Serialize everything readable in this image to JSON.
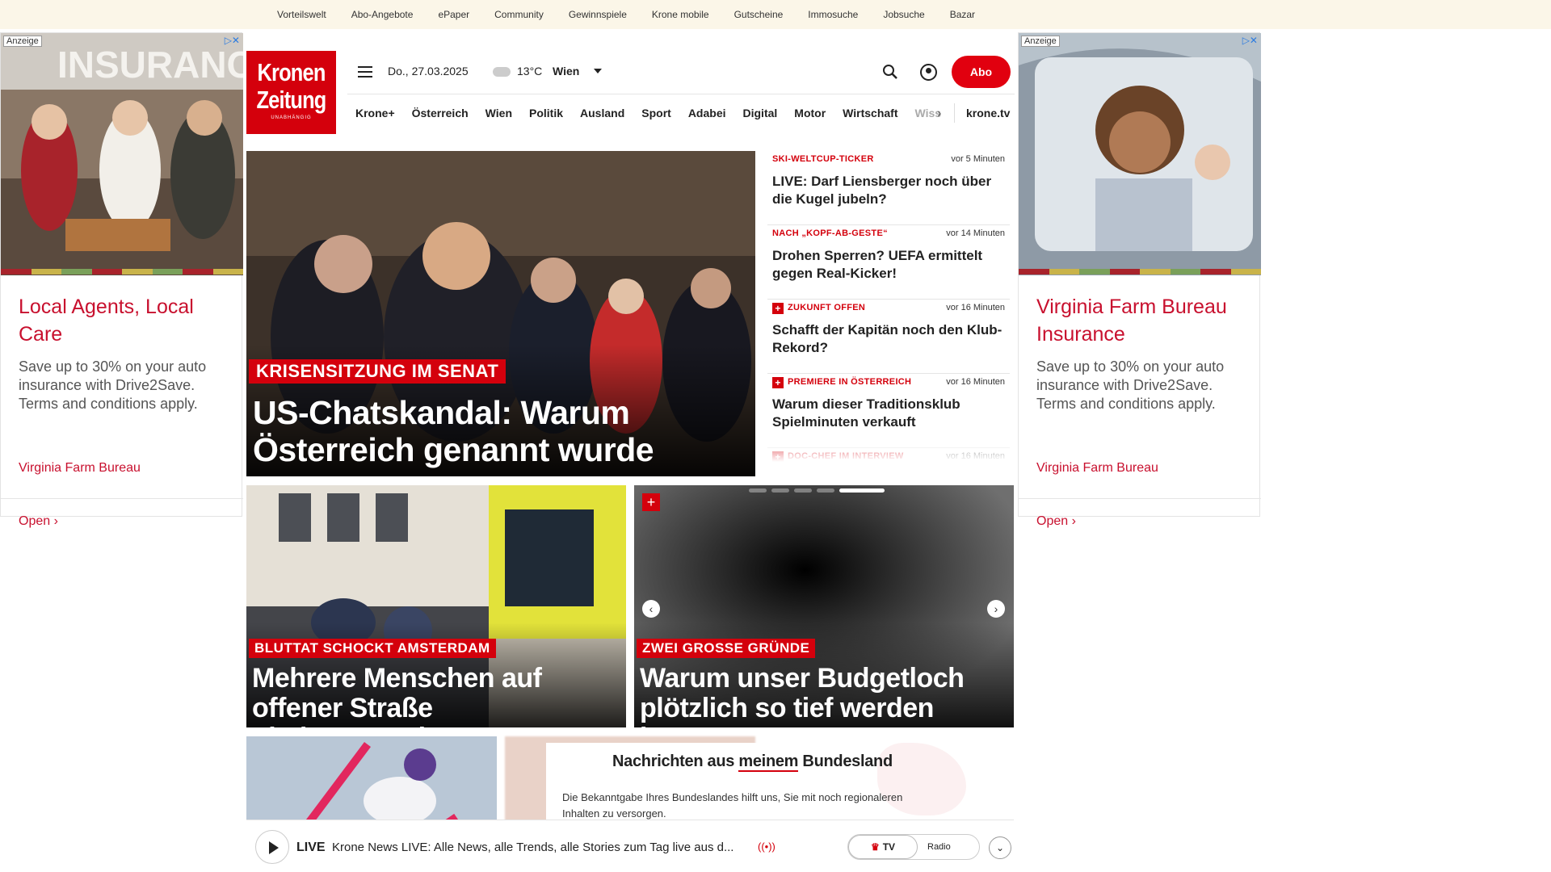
{
  "topnav": [
    "Vorteilswelt",
    "Abo-Angebote",
    "ePaper",
    "Community",
    "Gewinnspiele",
    "Krone mobile",
    "Gutscheine",
    "Immosuche",
    "Jobsuche",
    "Bazar"
  ],
  "ads": {
    "label": "Anzeige",
    "left": {
      "headline": "Local Agents, Local Care",
      "body": "Save up to 30% on your auto insurance with Drive2Save. Terms and conditions apply.",
      "brand": "Virginia Farm Bureau",
      "cta": "Open",
      "image_text": "INSURANC"
    },
    "right": {
      "headline": "Virginia Farm Bureau Insurance",
      "body": "Save up to 30% on your auto insurance with Drive2Save. Terms and conditions apply.",
      "brand": "Virginia Farm Bureau",
      "cta": "Open"
    }
  },
  "header": {
    "logo_line1": "Kronen",
    "logo_line2": "Zeitung",
    "logo_tag": "UNABHÄNGIG",
    "date": "Do., 27.03.2025",
    "temperature": "13°C",
    "city": "Wien",
    "abo_label": "Abo",
    "krone_tv": "krone.tv"
  },
  "nav": [
    "Krone+",
    "Österreich",
    "Wien",
    "Politik",
    "Ausland",
    "Sport",
    "Adabei",
    "Digital",
    "Motor",
    "Wirtschaft",
    "Wiss"
  ],
  "hero": {
    "kicker": "KRISENSITZUNG IM SENAT",
    "title": "US-Chatskandal: Warum Österreich genannt wurde"
  },
  "ticker": [
    {
      "kicker": "SKI-WELTCUP-TICKER",
      "time": "vor 5 Minuten",
      "headline": "LIVE: Darf Liensberger noch über die Kugel jubeln?",
      "plus": false
    },
    {
      "kicker": "NACH „KOPF-AB-GESTE“",
      "time": "vor 14 Minuten",
      "headline": "Drohen Sperren? UEFA ermittelt gegen Real-Kicker!",
      "plus": false
    },
    {
      "kicker": "ZUKUNFT OFFEN",
      "time": "vor 16 Minuten",
      "headline": "Schafft der Kapitän noch den Klub-Rekord?",
      "plus": true
    },
    {
      "kicker": "PREMIERE IN ÖSTERREICH",
      "time": "vor 16 Minuten",
      "headline": "Warum dieser Traditionsklub Spielminuten verkauft",
      "plus": true
    },
    {
      "kicker": "DOC-CHEF IM INTERVIEW",
      "time": "vor 16 Minuten",
      "headline": "",
      "plus": true
    }
  ],
  "cards": [
    {
      "kicker": "BLUTTAT SCHOCKT AMSTERDAM",
      "title": "Mehrere Menschen auf offener Straße niedergestochen"
    },
    {
      "kicker": "ZWEI GROSSE GRÜNDE",
      "title": "Warum unser Budgetloch plötzlich so tief werden konnte"
    }
  ],
  "modal": {
    "title_pre": "Nachrichten aus ",
    "title_u": "meinem",
    "title_post": " Bundesland",
    "body": "Die Bekanntgabe Ihres Bundeslandes hilft uns, Sie mit noch regionaleren Inhalten zu versorgen."
  },
  "livebar": {
    "live": "LIVE",
    "text": "Krone News LIVE: Alle News, alle Trends, alle Stories zum Tag live aus d...",
    "tv": "TV",
    "radio": "Radio"
  },
  "colors": {
    "brand_red": "#d4000c",
    "ad_red": "#c8102e"
  }
}
